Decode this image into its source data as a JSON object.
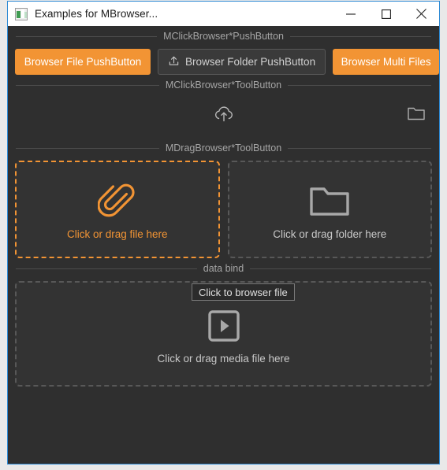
{
  "window": {
    "title": "Examples for MBrowser...",
    "icon": "app-window-icon",
    "border_color": "#2e8ad4",
    "background": "#2f2f2f",
    "controls": {
      "minimize": "minimize",
      "maximize": "maximize",
      "close": "close"
    }
  },
  "accent_color": "#f29434",
  "sections": [
    {
      "label": "MClickBrowser*PushButton",
      "buttons": [
        {
          "label": "Browser File PushButton",
          "style": "primary",
          "icon": ""
        },
        {
          "label": "Browser Folder PushButton",
          "style": "secondary",
          "icon": "upload-icon"
        },
        {
          "label": "Browser Multi Files",
          "style": "primary",
          "icon": ""
        }
      ]
    },
    {
      "label": "MClickBrowser*ToolButton",
      "tools": [
        {
          "icon": "cloud-upload-icon",
          "position": "center"
        },
        {
          "icon": "folder-icon",
          "position": "right"
        }
      ]
    },
    {
      "label": "MDragBrowser*ToolButton",
      "dropzones": [
        {
          "icon": "paperclip-icon",
          "label": "Click or drag file here",
          "state": "active"
        },
        {
          "icon": "folder-icon",
          "label": "Click or drag folder here",
          "state": "idle"
        }
      ]
    },
    {
      "label": "data bind",
      "dropzone": {
        "icon": "media-play-icon",
        "label": "Click or drag media file here",
        "state": "idle"
      }
    }
  ],
  "tooltip": {
    "text": "Click to browser file"
  }
}
